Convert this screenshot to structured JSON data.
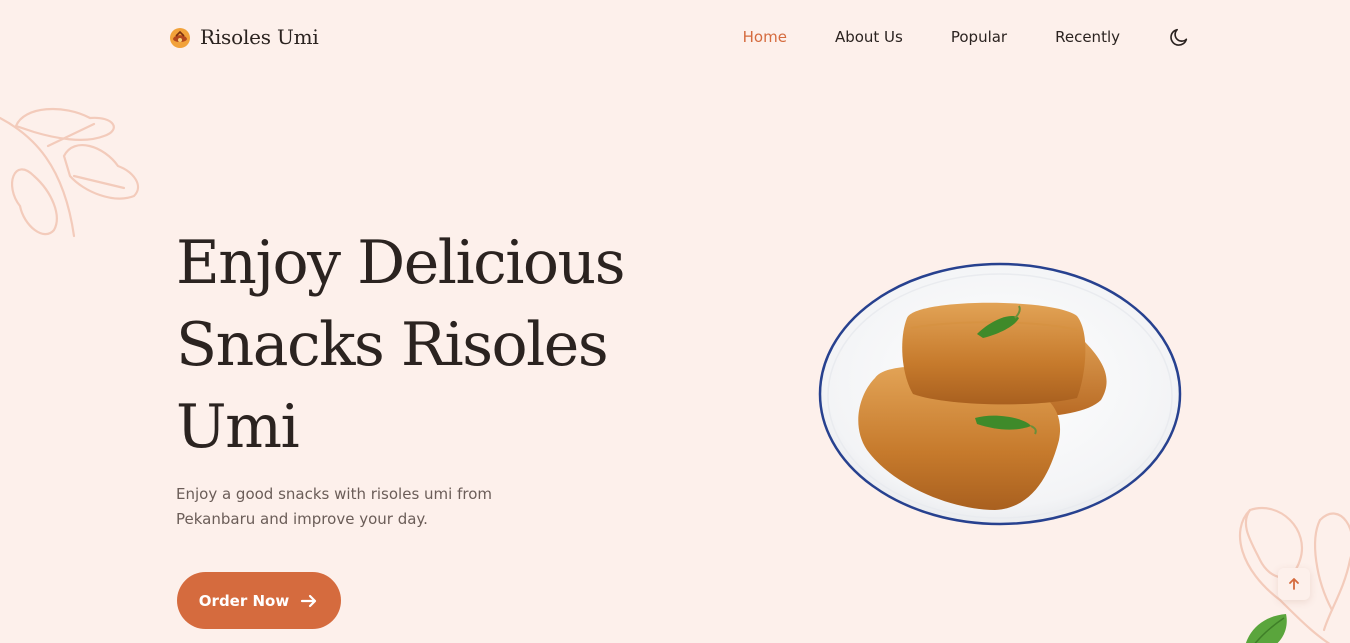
{
  "brand": {
    "name": "Risoles Umi",
    "logo_icon": "risoles-logo-icon"
  },
  "nav": {
    "items": [
      {
        "label": "Home",
        "active": true
      },
      {
        "label": "About Us",
        "active": false
      },
      {
        "label": "Popular",
        "active": false
      },
      {
        "label": "Recently",
        "active": false
      }
    ],
    "theme_icon": "moon-icon"
  },
  "hero": {
    "title": "Enjoy Delicious Snacks Risoles Umi",
    "description": "Enjoy a good snacks with risoles umi from Pekanbaru and improve your day.",
    "cta_label": "Order Now",
    "cta_icon": "arrow-right-icon",
    "image_icon": "risoles-plate-image"
  },
  "scroll_up": {
    "icon": "arrow-up-icon"
  },
  "colors": {
    "background": "#fdf0eb",
    "accent": "#d56b3e",
    "text": "#2b2320",
    "muted_text": "#6b5d58",
    "leaf_outline": "#f3cbbb"
  }
}
